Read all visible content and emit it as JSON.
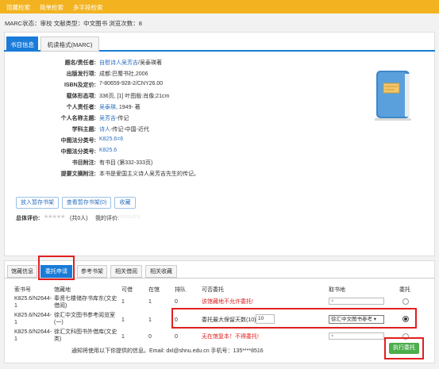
{
  "topnav": [
    "馆藏检索",
    "简单检索",
    "多字段检索"
  ],
  "status_line": "MARC状态：审校  文献类型：中文图书  浏览次数：8",
  "tabs": [
    "书目信息",
    "机读格式(MARC)"
  ],
  "fields": [
    {
      "label": "题名/责任者:",
      "value": "自慰诗人吴芳吉",
      "value2": "/吴泰瑛著"
    },
    {
      "label": "出版发行项:",
      "value": "成都:巴蜀书社,2006"
    },
    {
      "label": "ISBN及定价:",
      "value": "7-80659-928-2/CNY26.00"
    },
    {
      "label": "载体形态项:",
      "value": "336页, [1] 叶图版:肖像;21cm"
    },
    {
      "label": "个人责任者:",
      "value": "吴泰瑛",
      "value2": ", 1949- 著"
    },
    {
      "label": "个人名称主题:",
      "value": "吴芳吉",
      "value2": "-传记"
    },
    {
      "label": "学科主题:",
      "value": "诗人",
      "value2": "-传记-中国-近代"
    },
    {
      "label": "中图法分类号:",
      "value": "K825.6=6"
    },
    {
      "label": "中图法分类号:",
      "value": "K825.6"
    },
    {
      "label": "书目附注:",
      "value": "有书目 (第332-333页)"
    },
    {
      "label": "提要文摘附注:",
      "value": "本书是爱国主义诗人吴芳吉先生的传记。"
    }
  ],
  "actions": [
    "放入暂存书架",
    "查看暂存书架(0)",
    "收藏"
  ],
  "rating_label": "总体评价:",
  "rating_count": "(共0人)",
  "my_rating_label": "我的评价:",
  "tabs2": [
    "馆藏信息",
    "委托申请",
    "参考书架",
    "相关借阅",
    "相关收藏"
  ],
  "table_headers": [
    "索书号",
    "馆藏地",
    "可借",
    "在馆",
    "排队",
    "可否委托",
    "取书地",
    "委托"
  ],
  "rows": [
    {
      "call": "K825.6/N2644-1",
      "loc": "奉贤七楼储存书库东(文史借阅)",
      "borrow": "1",
      "inlib": "1",
      "queue": "0",
      "msg": "该馆藏地不允许委托!",
      "pickup": "",
      "radio_checked": false
    },
    {
      "call": "K825.6/N2644-1",
      "loc": "徐汇中文图书参考阅览室(一)",
      "borrow": "1",
      "inlib": "1",
      "queue": "0",
      "msg": "委托最大保留天数(10):",
      "days": "10",
      "pickup": "徐汇中文图书参考",
      "radio_checked": true
    },
    {
      "call": "K825.6/N2644-1",
      "loc": "徐汇文科图书外借库(文史类)",
      "borrow": "1",
      "inlib": "0",
      "queue": "0",
      "msg": "无在馆复本！不得委托!",
      "pickup": "",
      "radio_checked": false
    }
  ],
  "notice": "通知将使用以下你提供的信息。Email: dxl@shnu.edu.cn 手机号：135****8516",
  "exec_button": "执行委托",
  "colors": {
    "topbar": "#f3b320",
    "accent": "#1a7bd8",
    "highlight": "#e02020",
    "exec": "#4cae4c"
  }
}
